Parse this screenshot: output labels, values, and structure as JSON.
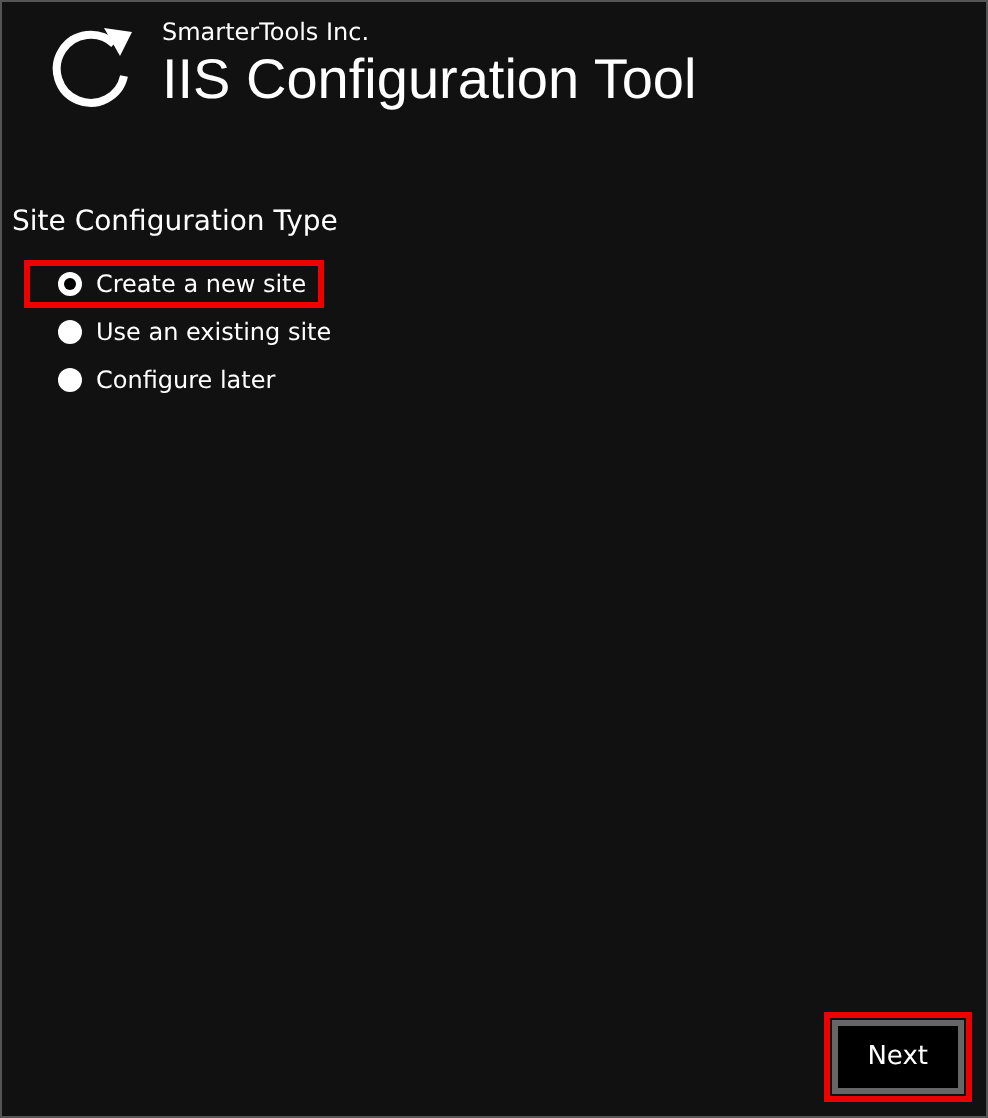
{
  "header": {
    "company": "SmarterTools Inc.",
    "title": "IIS Configuration Tool"
  },
  "section": {
    "label": "Site Configuration Type",
    "options": [
      {
        "label": "Create a new site",
        "selected": true,
        "highlighted": true
      },
      {
        "label": "Use an existing site",
        "selected": false,
        "highlighted": false
      },
      {
        "label": "Configure later",
        "selected": false,
        "highlighted": false
      }
    ]
  },
  "next_button": {
    "label": "Next",
    "highlighted": true
  }
}
